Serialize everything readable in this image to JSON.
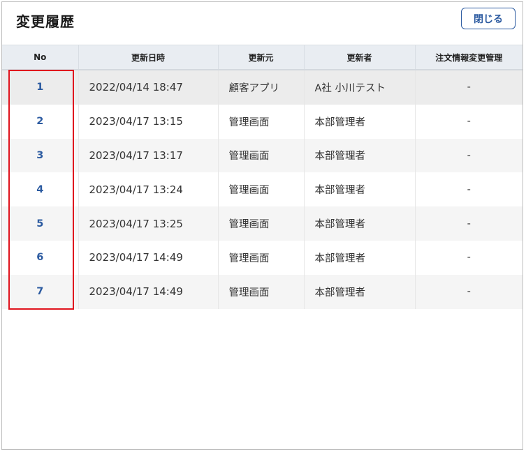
{
  "dialog": {
    "title": "変更履歴",
    "close_label": "閉じる"
  },
  "table": {
    "headers": {
      "no": "No",
      "datetime": "更新日時",
      "source": "更新元",
      "updater": "更新者",
      "order_change": "注文情報変更管理"
    },
    "rows": [
      {
        "no": "1",
        "datetime": "2022/04/14 18:47",
        "source": "顧客アプリ",
        "updater": "A社 小川テスト",
        "order_change": "-"
      },
      {
        "no": "2",
        "datetime": "2023/04/17 13:15",
        "source": "管理画面",
        "updater": "本部管理者",
        "order_change": "-"
      },
      {
        "no": "3",
        "datetime": "2023/04/17 13:17",
        "source": "管理画面",
        "updater": "本部管理者",
        "order_change": "-"
      },
      {
        "no": "4",
        "datetime": "2023/04/17 13:24",
        "source": "管理画面",
        "updater": "本部管理者",
        "order_change": "-"
      },
      {
        "no": "5",
        "datetime": "2023/04/17 13:25",
        "source": "管理画面",
        "updater": "本部管理者",
        "order_change": "-"
      },
      {
        "no": "6",
        "datetime": "2023/04/17 14:49",
        "source": "管理画面",
        "updater": "本部管理者",
        "order_change": "-"
      },
      {
        "no": "7",
        "datetime": "2023/04/17 14:49",
        "source": "管理画面",
        "updater": "本部管理者",
        "order_change": "-"
      }
    ]
  },
  "colors": {
    "accent": "#2b5aa0",
    "highlight": "#e0141e",
    "header_bg": "#e9edf2",
    "row_alt_bg": "#f5f5f5"
  }
}
